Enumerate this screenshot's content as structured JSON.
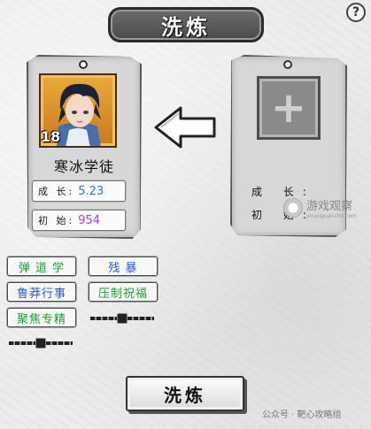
{
  "title": "洗炼",
  "help_icon": "?",
  "source_card": {
    "level": "18",
    "name": "寒冰学徒",
    "growth_label": "成  长:",
    "growth_value": "5.23",
    "init_label": "初  始:",
    "init_value": "954"
  },
  "target_card": {
    "empty_symbol": "+",
    "growth_label": "成  长:",
    "init_label": "初  始:"
  },
  "skills": [
    {
      "label": "弹 道 学",
      "color": "green"
    },
    {
      "label": "残   暴",
      "color": "blue"
    },
    {
      "label": "鲁莽行事",
      "color": "blue"
    },
    {
      "label": "压制祝福",
      "color": "green"
    },
    {
      "label": "聚焦专精",
      "color": "green"
    }
  ],
  "wash_button_label": "洗炼",
  "watermark_site": "游戏观察",
  "watermark_site_url": "youxiguancha.com",
  "watermark_account": "公众号 · 靶心攻略组",
  "colors": {
    "growth_value": "#2f6fd8",
    "init_value": "#9b49c9",
    "skill_green": "#1f9a3a",
    "skill_blue": "#2d56c9"
  }
}
